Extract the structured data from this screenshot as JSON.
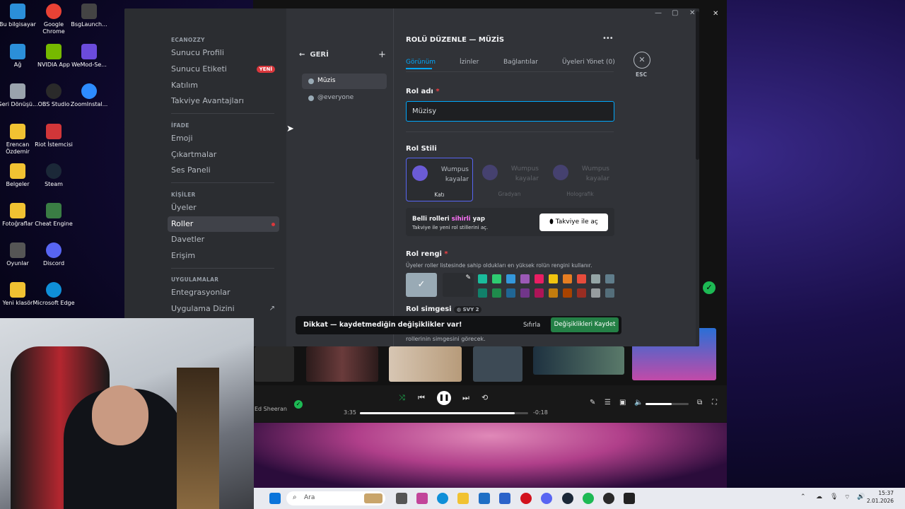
{
  "desktop": {
    "icons": [
      {
        "label": "Bu bilgisayar",
        "color": "#2b8fd9"
      },
      {
        "label": "Google Chrome",
        "color": "#e94235"
      },
      {
        "label": "BsgLaunch...",
        "color": "#444444"
      },
      {
        "label": "Ağ",
        "color": "#2b8fd9"
      },
      {
        "label": "NVIDIA App",
        "color": "#76b900"
      },
      {
        "label": "WeMod-Se...",
        "color": "#6b4bdc"
      },
      {
        "label": "Geri Dönüşü...",
        "color": "#9aa3ad"
      },
      {
        "label": "OBS Studio",
        "color": "#2a2a2a"
      },
      {
        "label": "ZoomInstal...",
        "color": "#2d8cff"
      },
      {
        "label": "Erencan Özdemir",
        "color": "#f1c232"
      },
      {
        "label": "Riot İstemcisi",
        "color": "#d13639"
      },
      {
        "label": "Belgeler",
        "color": "#f1c232"
      },
      {
        "label": "Steam",
        "color": "#1b2838"
      },
      {
        "label": "Fotoğraflar",
        "color": "#f1c232"
      },
      {
        "label": "Cheat Engine",
        "color": "#3a7d44"
      },
      {
        "label": "Oyunlar",
        "color": "#555555"
      },
      {
        "label": "Discord",
        "color": "#5865f2"
      },
      {
        "label": "Yeni klasör",
        "color": "#f1c232"
      },
      {
        "label": "Microsoft Edge",
        "color": "#0f8fd8"
      }
    ]
  },
  "discord": {
    "sidebar": {
      "server_name": "ECANOZZY",
      "items_server": [
        "Sunucu Profili",
        "Sunucu Etiketi",
        "Katılım",
        "Takviye Avantajları"
      ],
      "new_badge": "YENİ",
      "section_expression": "İFADE",
      "items_expression": [
        "Emoji",
        "Çıkartmalar",
        "Ses Paneli"
      ],
      "section_people": "KİŞİLER",
      "items_people": [
        "Üyeler",
        "Roller",
        "Davetler",
        "Erişim"
      ],
      "section_apps": "UYGULAMALAR",
      "items_apps": [
        "Entegrasyonlar",
        "Uygulama Dizini"
      ]
    },
    "rolelist": {
      "back_label": "GERİ",
      "add_symbol": "+",
      "roles": [
        {
          "name": "Müzis",
          "color": "#99aab5"
        },
        {
          "name": "@everyone",
          "color": "#99aab5"
        }
      ]
    },
    "editor": {
      "title": "ROLÜ DÜZENLE — MÜZİS",
      "more_symbol": "•••",
      "tabs": [
        "Görünüm",
        "İzinler",
        "Bağlantılar",
        "Üyeleri Yönet (0)"
      ],
      "esc_label": "ESC",
      "role_name_label": "Rol adı",
      "required_mark": "*",
      "role_name_value": "Müzisy",
      "role_style_label": "Rol Stili",
      "styles": [
        {
          "sample": "Wumpus kayalar",
          "name": "Katı"
        },
        {
          "sample": "Wumpus kayalar",
          "name": "Gradyan"
        },
        {
          "sample": "Wumpus kayalar",
          "name": "Holografik"
        }
      ],
      "promo_title_pre": "Belli rolleri ",
      "promo_title_magic": "sihirli",
      "promo_title_post": " yap",
      "promo_sub": "Takviye ile yeni rol stillerini aç.",
      "promo_button": "Takviye ile aç",
      "color_label": "Rol rengi",
      "color_desc": "Üyeler roller listesinde sahip oldukları en yüksek rolün rengini kullanır.",
      "swatches_top": [
        "#1abc9c",
        "#2ecc71",
        "#3498db",
        "#9b59b6",
        "#e91e63",
        "#f1c40f",
        "#e67e22",
        "#e74c3c",
        "#95a5a6",
        "#607d8b"
      ],
      "swatches_bottom": [
        "#11806a",
        "#1f8b4c",
        "#206694",
        "#71368a",
        "#ad1457",
        "#c27c0e",
        "#a84300",
        "#992d22",
        "#979c9f",
        "#546e7a"
      ],
      "default_color": "#99aab5",
      "icon_label": "Rol simgesi",
      "icon_badge": "SVY 2",
      "icon_hint": "rollerinin simgesini görecek."
    },
    "notice": {
      "text": "Dikkat — kaydetmediğin değişiklikler var!",
      "reset": "Sıfırla",
      "save": "Değişiklikleri Kaydet"
    }
  },
  "player": {
    "artist": "Ed Sheeran",
    "elapsed": "3:35",
    "remaining": "-0:18",
    "progress": 0.92,
    "volume": 0.6
  },
  "taskbar": {
    "search_placeholder": "Ara",
    "time": "15:37",
    "date": "2.01.2026"
  }
}
